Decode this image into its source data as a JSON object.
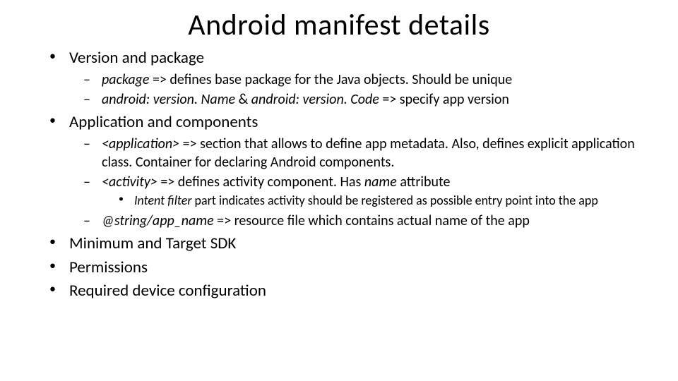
{
  "title": "Android manifest details",
  "b1": {
    "label": "Version and package",
    "s1": {
      "key": "package",
      "text": " => defines base package for the Java objects. Should be unique"
    },
    "s2": {
      "key1": "android: version. Name",
      "amp": " & ",
      "key2": "android: version. Code",
      "text": " => specify app version"
    }
  },
  "b2": {
    "label": "Application and components",
    "s1": {
      "key": "<application>",
      "text": " => section that allows to define app metadata. Also, defines explicit application class. Container for declaring Android components."
    },
    "s2": {
      "key": "<activity>",
      "text": " => defines activity component. Has ",
      "key2": "name",
      "text2": " attribute",
      "sub": {
        "key": "Intent filter",
        "text": " part indicates activity should be registered as possible entry point into the app"
      }
    },
    "s3": {
      "key": "@string/app_name",
      "text": " => resource file which contains actual name of the app"
    }
  },
  "b3": {
    "label": "Minimum and Target SDK"
  },
  "b4": {
    "label": "Permissions"
  },
  "b5": {
    "label": "Required device configuration"
  }
}
